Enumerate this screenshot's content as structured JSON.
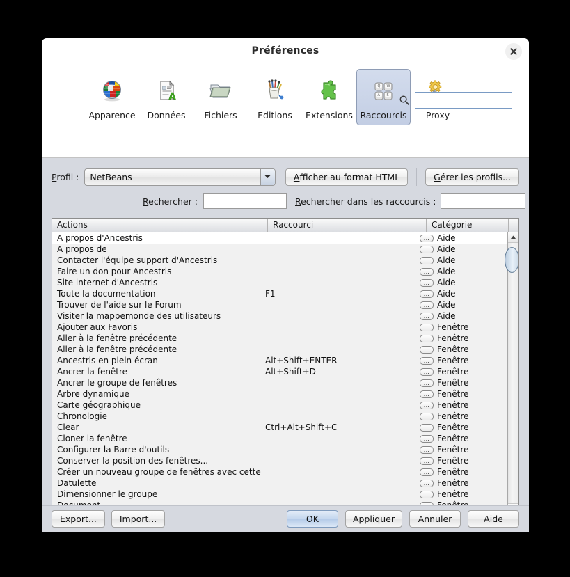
{
  "dialog": {
    "title": "Préférences",
    "close_icon": "close-icon"
  },
  "toolbar": {
    "items": [
      {
        "label": "Apparence",
        "icon": "globe-flags-icon",
        "selected": false
      },
      {
        "label": "Données",
        "icon": "document-a-icon",
        "selected": false
      },
      {
        "label": "Fichiers",
        "icon": "folder-icon",
        "selected": false
      },
      {
        "label": "Editions",
        "icon": "pencil-cup-icon",
        "selected": false
      },
      {
        "label": "Extensions",
        "icon": "puzzle-piece-icon",
        "selected": false
      },
      {
        "label": "Raccourcis",
        "icon": "keyboard-keys-icon",
        "selected": true
      },
      {
        "label": "Proxy",
        "icon": "gear-wrench-icon",
        "selected": false
      }
    ],
    "search_icon": "search-icon",
    "search_value": "",
    "search_placeholder": ""
  },
  "profile": {
    "label": "Profil :",
    "label_mnemonic": "P",
    "selected": "NetBeans",
    "options": [
      "NetBeans"
    ],
    "dropdown_icon": "chevron-down-icon",
    "html_button": "Afficher au format HTML",
    "html_button_mnemonic": "A",
    "manage_button": "Gérer les profils...",
    "manage_button_mnemonic": "G"
  },
  "search": {
    "find_label": "Rechercher :",
    "find_mnemonic": "R",
    "find_value": "",
    "find_placeholder": "",
    "in_shortcuts_label": "Rechercher dans les raccourcis :",
    "in_shortcuts_mnemonic": "R",
    "in_shortcuts_value": "",
    "in_shortcuts_placeholder": "",
    "ellipsis_button": "...",
    "ellipsis_icon": "ellipsis-icon"
  },
  "table": {
    "columns": [
      "Actions",
      "Raccourci",
      "Catégorie"
    ],
    "row_button_icon": "ellipsis-button-icon",
    "row_button_label": "...",
    "rows": [
      {
        "action": "A propos d'Ancestris",
        "shortcut": "",
        "category": "Aide"
      },
      {
        "action": "A propos de",
        "shortcut": "",
        "category": "Aide"
      },
      {
        "action": "Contacter l'équipe support d'Ancestris",
        "shortcut": "",
        "category": "Aide"
      },
      {
        "action": "Faire un don pour Ancestris",
        "shortcut": "",
        "category": "Aide"
      },
      {
        "action": "Site internet d'Ancestris",
        "shortcut": "",
        "category": "Aide"
      },
      {
        "action": "Toute la documentation",
        "shortcut": "F1",
        "category": "Aide"
      },
      {
        "action": "Trouver de l'aide sur le Forum",
        "shortcut": "",
        "category": "Aide"
      },
      {
        "action": "Visiter la mappemonde des utilisateurs",
        "shortcut": "",
        "category": "Aide"
      },
      {
        "action": "Ajouter aux Favoris",
        "shortcut": "",
        "category": "Fenêtre"
      },
      {
        "action": "Aller à la fenêtre précédente",
        "shortcut": "",
        "category": "Fenêtre"
      },
      {
        "action": "Aller à la fenêtre précédente",
        "shortcut": "",
        "category": "Fenêtre"
      },
      {
        "action": "Ancestris en plein écran",
        "shortcut": "Alt+Shift+ENTER",
        "category": "Fenêtre"
      },
      {
        "action": "Ancrer la fenêtre",
        "shortcut": "Alt+Shift+D",
        "category": "Fenêtre"
      },
      {
        "action": "Ancrer le groupe de fenêtres",
        "shortcut": "",
        "category": "Fenêtre"
      },
      {
        "action": "Arbre dynamique",
        "shortcut": "",
        "category": "Fenêtre"
      },
      {
        "action": "Carte géographique",
        "shortcut": "",
        "category": "Fenêtre"
      },
      {
        "action": "Chronologie",
        "shortcut": "",
        "category": "Fenêtre"
      },
      {
        "action": "Clear",
        "shortcut": "Ctrl+Alt+Shift+C",
        "category": "Fenêtre"
      },
      {
        "action": "Cloner la fenêtre",
        "shortcut": "",
        "category": "Fenêtre"
      },
      {
        "action": "Configurer la Barre d'outils",
        "shortcut": "",
        "category": "Fenêtre"
      },
      {
        "action": "Conserver la position des fenêtres...",
        "shortcut": "",
        "category": "Fenêtre"
      },
      {
        "action": "Créer un nouveau groupe de fenêtres avec cette fe...",
        "shortcut": "",
        "category": "Fenêtre"
      },
      {
        "action": "Datulette",
        "shortcut": "",
        "category": "Fenêtre"
      },
      {
        "action": "Dimensionner le groupe",
        "shortcut": "",
        "category": "Fenêtre"
      },
      {
        "action": "Document",
        "shortcut": "",
        "category": "Fenêtre"
      }
    ],
    "scrollbar": {
      "up_icon": "scroll-up-arrow-icon",
      "down_icon": "scroll-down-arrow-icon",
      "thumb": "scrollbar-thumb"
    }
  },
  "footer": {
    "export": "Export...",
    "export_mnemonic": "t",
    "import": "Import...",
    "import_mnemonic": "I",
    "ok": "OK",
    "apply": "Appliquer",
    "cancel": "Annuler",
    "help": "Aide",
    "help_mnemonic": "A"
  }
}
